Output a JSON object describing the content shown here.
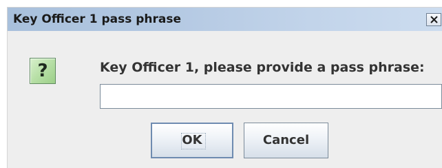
{
  "dialog": {
    "title": "Key Officer 1 pass phrase",
    "close_icon": "close-icon",
    "question_icon": "question-icon",
    "question_glyph": "?",
    "prompt": "Key Officer 1, please provide a pass phrase:",
    "input": {
      "value": "",
      "placeholder": ""
    },
    "ok_label": "OK",
    "cancel_label": "Cancel"
  },
  "colors": {
    "titlebar": "#b3c8e2",
    "background": "#eeeeee",
    "icon_green": "#b7dfa6",
    "button_border": "#7a8a99"
  }
}
